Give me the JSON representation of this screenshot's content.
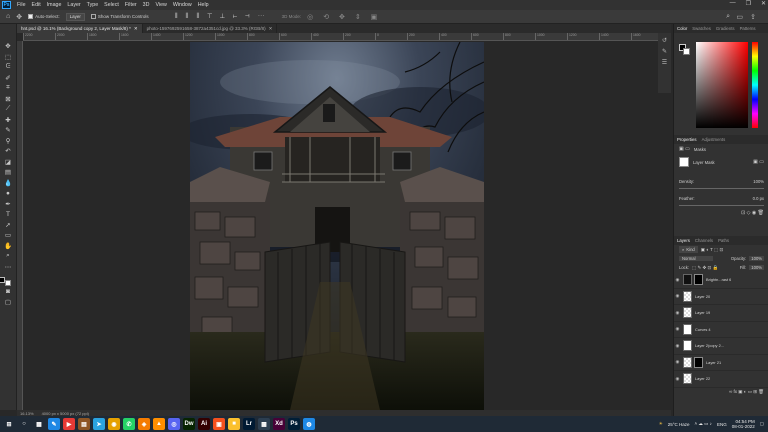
{
  "app": "Ps",
  "menu": [
    "File",
    "Edit",
    "Image",
    "Layer",
    "Type",
    "Select",
    "Filter",
    "3D",
    "View",
    "Window",
    "Help"
  ],
  "options": {
    "auto_select_label": "Auto-Select:",
    "auto_select_value": "Layer",
    "transform_controls_label": "Show Transform Controls",
    "mode_label": "3D Mode:"
  },
  "tabs": [
    {
      "label": "hnt.psd @ 16.1% (Background copy 2, Layer Mask/8) *",
      "active": true
    },
    {
      "label": "photo-1597692591658-3872a4351cd.jpg @ 33.3% (RGB/8)",
      "active": false
    }
  ],
  "ruler_ticks": [
    "2200",
    "2000",
    "1800",
    "1600",
    "1400",
    "1200",
    "1000",
    "800",
    "600",
    "400",
    "200",
    "0",
    "200",
    "400",
    "600",
    "800",
    "1000",
    "1200",
    "1400",
    "1600",
    "1800",
    "2000",
    "2200",
    "2400",
    "2600",
    "2800",
    "3000",
    "3200",
    "3400",
    "3600",
    "3800",
    "4000",
    "4200",
    "4400",
    "4600",
    "4800",
    "5000",
    "5200",
    "5400",
    "5600"
  ],
  "status": {
    "zoom": "16.13%",
    "doc": "4000 px x 5000 px (72 ppi)"
  },
  "color_panel": {
    "tabs": [
      "Color",
      "Swatches",
      "Gradients",
      "Patterns"
    ]
  },
  "properties": {
    "tabs": [
      "Properties",
      "Adjustments"
    ],
    "section": "Masks",
    "mask_label": "Layer Mask",
    "density_label": "Density:",
    "density_value": "100%",
    "feather_label": "Feather:",
    "feather_value": "0.0 px"
  },
  "layers_panel": {
    "tabs": [
      "Layers",
      "Channels",
      "Paths"
    ],
    "kind": "Kind",
    "blend_mode": "Normal",
    "opacity_label": "Opacity:",
    "opacity_value": "100%",
    "lock_label": "Lock:",
    "fill_label": "Fill:",
    "fill_value": "100%",
    "layers": [
      {
        "name": "Brightn...rast 6",
        "thumb": "dark",
        "mask": true
      },
      {
        "name": "Layer 20",
        "thumb": "checker",
        "mask": false
      },
      {
        "name": "Layer 19",
        "thumb": "checker",
        "mask": false
      },
      {
        "name": "Curves 4",
        "thumb": "white",
        "mask": false
      },
      {
        "name": "Layer 2(copy 2...",
        "thumb": "white",
        "mask": false
      },
      {
        "name": "Layer 21",
        "thumb": "checker",
        "mask": true
      },
      {
        "name": "Layer 22",
        "thumb": "checker",
        "mask": false
      }
    ]
  },
  "taskbar": {
    "weather": "25°C Haze",
    "lang": "ENG",
    "time": "04:54 PM",
    "date": "08-01-2022",
    "apps": [
      {
        "label": "⊞",
        "color": "#1f2a36"
      },
      {
        "label": "○",
        "color": "#1f2a36"
      },
      {
        "label": "▦",
        "color": "#1f2a36"
      },
      {
        "label": "✎",
        "color": "#1e88e5"
      },
      {
        "label": "▶",
        "color": "#e53935"
      },
      {
        "label": "▤",
        "color": "#8d5524"
      },
      {
        "label": "➤",
        "color": "#2aa3e0"
      },
      {
        "label": "◉",
        "color": "#e6a100"
      },
      {
        "label": "✆",
        "color": "#25d366"
      },
      {
        "label": "◈",
        "color": "#f57c00"
      },
      {
        "label": "▲",
        "color": "#ff8f00"
      },
      {
        "label": "◎",
        "color": "#5865f2"
      },
      {
        "label": "Dw",
        "color": "#072401"
      },
      {
        "label": "Ai",
        "color": "#330000"
      },
      {
        "label": "▣",
        "color": "#f4511e"
      },
      {
        "label": "■",
        "color": "#fbc02d"
      },
      {
        "label": "Lr",
        "color": "#001a33"
      },
      {
        "label": "▩",
        "color": "#2c3e50"
      },
      {
        "label": "Xd",
        "color": "#470137"
      },
      {
        "label": "Ps",
        "color": "#001e36"
      },
      {
        "label": "◍",
        "color": "#1e88e5"
      }
    ]
  },
  "colors": {
    "ps_blue": "#31a8ff",
    "panel": "#323232",
    "canvas_bg": "#282828"
  }
}
